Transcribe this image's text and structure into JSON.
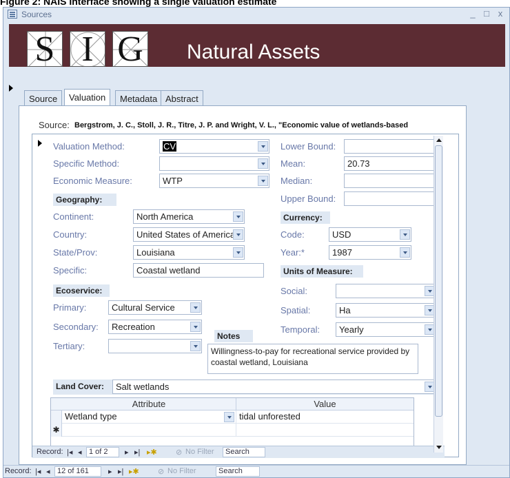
{
  "figure_caption": "Figure 2: NAIS Interface showing a single valuation estimate",
  "window": {
    "title": "Sources",
    "controls": [
      "_",
      "□",
      "x"
    ]
  },
  "banner": {
    "logo_letters": [
      "S",
      "I",
      "G"
    ],
    "title": "Natural Assets",
    "color": "#5c2c33"
  },
  "tabs": [
    {
      "label": "Source",
      "active": false
    },
    {
      "label": "Valuation",
      "active": true
    },
    {
      "label": "Metadata",
      "active": false
    },
    {
      "label": "Abstract",
      "active": false
    }
  ],
  "source": {
    "label": "Source:",
    "text": "Bergstrom, J. C., Stoll, J. R., Titre, J. P. and Wright, V. L., \"Economic value of wetlands-based"
  },
  "valuation": {
    "method_label": "Valuation Method:",
    "method_value": "CV",
    "specific_label": "Specific Method:",
    "specific_value": "",
    "measure_label": "Economic Measure:",
    "measure_value": "WTP"
  },
  "bounds": {
    "lower_label": "Lower Bound:",
    "lower_value": "",
    "mean_label": "Mean:",
    "mean_value": "20.73",
    "median_label": "Median:",
    "median_value": "",
    "upper_label": "Upper Bound:",
    "upper_value": ""
  },
  "geography": {
    "header": "Geography:",
    "continent_label": "Continent:",
    "continent_value": "North America",
    "country_label": "Country:",
    "country_value": "United States of America",
    "state_label": "State/Prov:",
    "state_value": "Louisiana",
    "specific_label": "Specific:",
    "specific_value": "Coastal wetland"
  },
  "currency": {
    "header": "Currency:",
    "code_label": "Code:",
    "code_value": "USD",
    "year_label": "Year:*",
    "year_value": "1987"
  },
  "units": {
    "header": "Units of Measure:",
    "social_label": "Social:",
    "social_value": "",
    "spatial_label": "Spatial:",
    "spatial_value": "Ha",
    "temporal_label": "Temporal:",
    "temporal_value": "Yearly"
  },
  "ecoservice": {
    "header": "Ecoservice:",
    "primary_label": "Primary:",
    "primary_value": "Cultural Service",
    "secondary_label": "Secondary:",
    "secondary_value": "Recreation",
    "tertiary_label": "Tertiary:",
    "tertiary_value": ""
  },
  "notes": {
    "header": "Notes",
    "text": "Willingness-to-pay for recreational service provided by coastal wetland, Louisiana"
  },
  "land_cover": {
    "label": "Land Cover:",
    "value": "Salt wetlands"
  },
  "attributes": {
    "columns": [
      "Attribute",
      "Value"
    ],
    "rows": [
      {
        "attribute": "Wetland type",
        "value": "tidal unforested"
      }
    ],
    "new_row_marker": "✱"
  },
  "sub_nav": {
    "record_label": "Record:",
    "position": "1 of 2",
    "no_filter": "No Filter",
    "search": "Search"
  },
  "main_nav": {
    "record_label": "Record:",
    "position": "12 of 161",
    "no_filter": "No Filter",
    "search": "Search"
  }
}
